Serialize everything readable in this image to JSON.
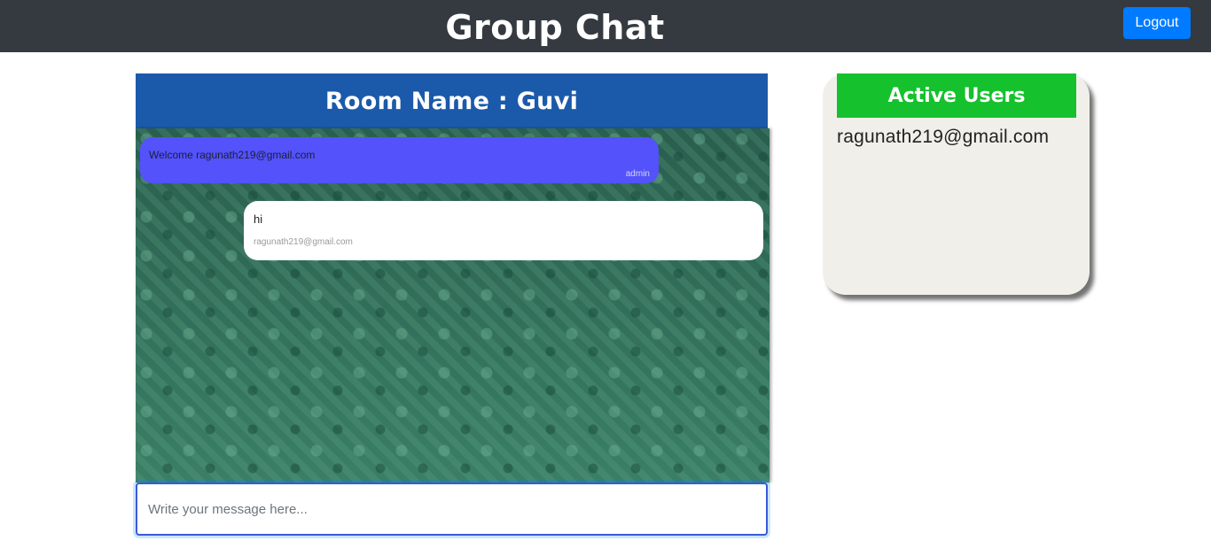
{
  "header": {
    "title": "Group Chat",
    "logout_label": "Logout"
  },
  "room": {
    "label": "Room Name : Guvi"
  },
  "messages": [
    {
      "text": "Welcome ragunath219@gmail.com",
      "sender": "admin"
    },
    {
      "text": "hi",
      "sender": "ragunath219@gmail.com"
    }
  ],
  "composer": {
    "placeholder": "Write your message here..."
  },
  "active_users": {
    "title": "Active Users",
    "users": [
      "ragunath219@gmail.com"
    ]
  },
  "colors": {
    "navbar": "#343a40",
    "logout": "#007bff",
    "room_header": "#1b5aab",
    "admin_bubble": "#5352fb",
    "user_bubble": "#ffffff",
    "active_users_header": "#15c12d",
    "users_card": "#f0efea"
  }
}
